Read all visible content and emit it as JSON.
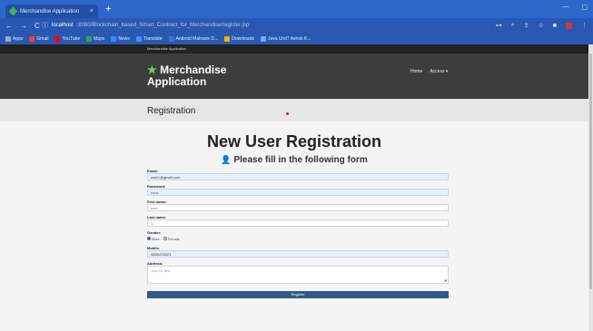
{
  "browser": {
    "tab_title": "Merchandise Application",
    "tab_close": "×",
    "new_tab": "+",
    "url_host": "localhost",
    "url_path": ":8080/Blockchain_based_Smart_Contract_for_Merchandise/register.jsp",
    "bookmarks": [
      {
        "label": "Apps",
        "color": "#9aa9c9"
      },
      {
        "label": "Gmail",
        "color": "#ea4335"
      },
      {
        "label": "YouTube",
        "color": "#ff0000"
      },
      {
        "label": "Maps",
        "color": "#34a853"
      },
      {
        "label": "News",
        "color": "#4285f4"
      },
      {
        "label": "Translate",
        "color": "#4a8af4"
      },
      {
        "label": "Android Malware D...",
        "color": "#3b6fd0"
      },
      {
        "label": "Downloads",
        "color": "#f2b500"
      },
      {
        "label": "Java Unit7 Ashok K...",
        "color": "#6fa8ff"
      }
    ]
  },
  "site": {
    "topbar_label": "Merchandise Application",
    "brand_line1": "Merchandise",
    "brand_line2": "Application",
    "menu": [
      "Home",
      "Access ▾"
    ],
    "subheader_title": "Registration"
  },
  "form": {
    "heading": "New User Registration",
    "subheading": "Please fill in the following form",
    "email_label": "Email:",
    "email_value": "user1@gmail.com",
    "password_label": "Password:",
    "password_value": "••••••",
    "firstname_label": "First name:",
    "firstname_value": "user",
    "lastname_label": "Last name:",
    "lastname_value": "1",
    "gender_label": "Gender:",
    "gender_options": [
      "Male",
      "Female"
    ],
    "mobile_label": "Mobile:",
    "mobile_value": "9865478521",
    "address_label": "Address:",
    "address_value": "Just for Test",
    "register_label": "Register"
  }
}
